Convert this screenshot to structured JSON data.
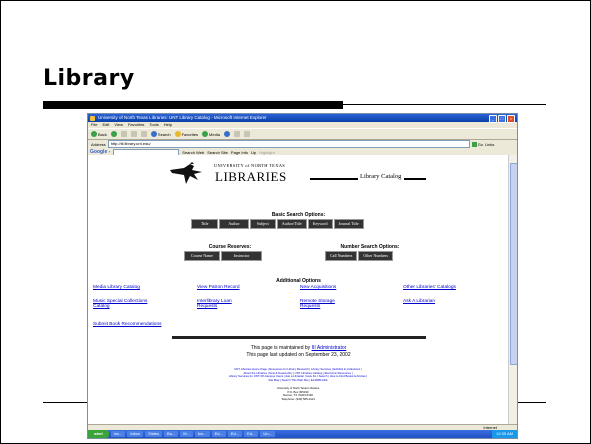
{
  "slide": {
    "title": "Library"
  },
  "browser": {
    "window_title": "University of North Texas Libraries: UNT Library Catalog - Microsoft Internet Explorer",
    "menu": [
      "File",
      "Edit",
      "View",
      "Favorites",
      "Tools",
      "Help"
    ],
    "toolbar": {
      "back": "Back",
      "search": "Search",
      "favorites": "Favorites",
      "media": "Media"
    },
    "address": {
      "label": "Address",
      "url": "http://iii.library.unt.edu/",
      "go": "Go",
      "links": "Links"
    },
    "google_bar": {
      "logo": "Google -",
      "search_web": "Search Web",
      "search_site": "Search Site",
      "page_info": "Page Info",
      "up": "Up",
      "highlight": "Highlight"
    },
    "status": {
      "zone": "Internet"
    },
    "taskbar": {
      "start": "start",
      "items": [
        "Inc...",
        "Inbox",
        "Slides",
        "Bo...",
        "M...",
        "Inc...",
        "Ed...",
        "Ed...",
        "Ed...",
        "Un..."
      ],
      "clock": "12:35 AM"
    }
  },
  "page": {
    "univ_line": "UNIVERSITY of NORTH TEXAS",
    "libraries": "LIBRARIES",
    "catalog": "Library Catalog",
    "basic_search_heading": "Basic Search Options:",
    "basic_buttons": [
      "Title",
      "Author",
      "Subject",
      "Author/Title",
      "Keyword",
      "Journal Title"
    ],
    "course_reserves_heading": "Course Reserves:",
    "course_buttons": [
      "Course Name",
      "Instructor"
    ],
    "number_search_heading": "Number Search Options:",
    "number_buttons": [
      "Call Numbers",
      "Other Numbers"
    ],
    "additional_heading": "Additional Options",
    "options": {
      "media": "Media Library Catalog",
      "patron": "View Patron Record",
      "acquisitions": "New Acquisitions",
      "other_catalogs": "Other Libraries' Catalogs",
      "music": "Music Special Collections Catalog",
      "ill": "Interlibrary Loan Requests",
      "remote": "Remote Storage Requests",
      "ask": "Ask A Librarian",
      "recommend": "Submit Book Recommendations"
    },
    "maintained_prefix": "This page is maintained by",
    "maintained_link": "III Administrator",
    "updated": "This page last updated on September 23, 2002",
    "footer_links": [
      "UNT Libraries Home Page | Resources for Library Research | Library Services | Exhibits & Collections |",
      "About the Libraries | New & Noteworthy | UNT Libraries Catalog | Electronic Resources |",
      "Library Services for UNT Off-Campus Users | Ask a Librarian | How Do I Search | How to Find Books & Articles |",
      "Site Map | Search This Web Site | Ed.RDB-ADA"
    ],
    "address_lines": [
      "University of North Texas Libraries",
      "P.O. Box 305190",
      "Denton, TX 76203-5190",
      "Telephone: (940) 565-2413"
    ]
  }
}
